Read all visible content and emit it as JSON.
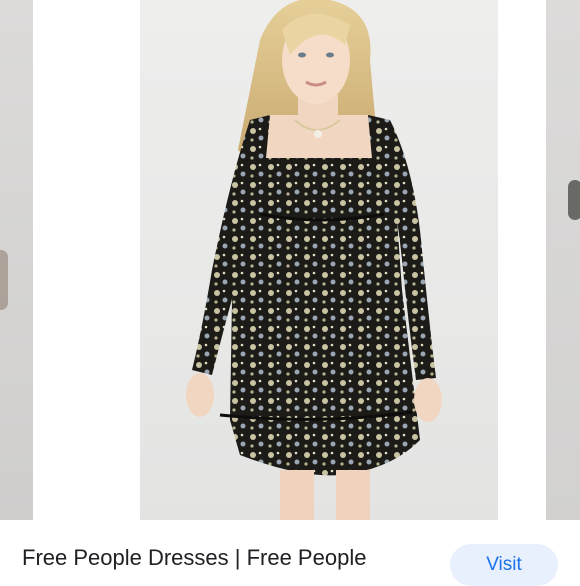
{
  "result": {
    "title": "Free People Dresses | Free People",
    "visit_label": "Visit"
  },
  "colors": {
    "dress": "#1c1b18",
    "print": "#c9c3a2",
    "visit_bg": "#e8f0fe",
    "visit_text": "#1a73e8"
  }
}
